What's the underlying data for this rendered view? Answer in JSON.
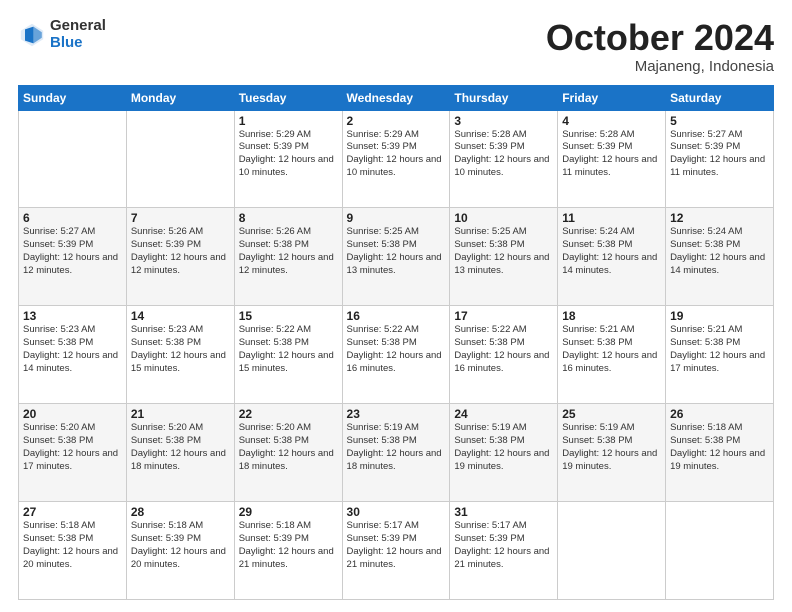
{
  "header": {
    "logo_general": "General",
    "logo_blue": "Blue",
    "title": "October 2024",
    "location": "Majaneng, Indonesia"
  },
  "weekdays": [
    "Sunday",
    "Monday",
    "Tuesday",
    "Wednesday",
    "Thursday",
    "Friday",
    "Saturday"
  ],
  "rows": [
    [
      {
        "day": "",
        "info": ""
      },
      {
        "day": "",
        "info": ""
      },
      {
        "day": "1",
        "info": "Sunrise: 5:29 AM\nSunset: 5:39 PM\nDaylight: 12 hours and 10 minutes."
      },
      {
        "day": "2",
        "info": "Sunrise: 5:29 AM\nSunset: 5:39 PM\nDaylight: 12 hours and 10 minutes."
      },
      {
        "day": "3",
        "info": "Sunrise: 5:28 AM\nSunset: 5:39 PM\nDaylight: 12 hours and 10 minutes."
      },
      {
        "day": "4",
        "info": "Sunrise: 5:28 AM\nSunset: 5:39 PM\nDaylight: 12 hours and 11 minutes."
      },
      {
        "day": "5",
        "info": "Sunrise: 5:27 AM\nSunset: 5:39 PM\nDaylight: 12 hours and 11 minutes."
      }
    ],
    [
      {
        "day": "6",
        "info": "Sunrise: 5:27 AM\nSunset: 5:39 PM\nDaylight: 12 hours and 12 minutes."
      },
      {
        "day": "7",
        "info": "Sunrise: 5:26 AM\nSunset: 5:39 PM\nDaylight: 12 hours and 12 minutes."
      },
      {
        "day": "8",
        "info": "Sunrise: 5:26 AM\nSunset: 5:38 PM\nDaylight: 12 hours and 12 minutes."
      },
      {
        "day": "9",
        "info": "Sunrise: 5:25 AM\nSunset: 5:38 PM\nDaylight: 12 hours and 13 minutes."
      },
      {
        "day": "10",
        "info": "Sunrise: 5:25 AM\nSunset: 5:38 PM\nDaylight: 12 hours and 13 minutes."
      },
      {
        "day": "11",
        "info": "Sunrise: 5:24 AM\nSunset: 5:38 PM\nDaylight: 12 hours and 14 minutes."
      },
      {
        "day": "12",
        "info": "Sunrise: 5:24 AM\nSunset: 5:38 PM\nDaylight: 12 hours and 14 minutes."
      }
    ],
    [
      {
        "day": "13",
        "info": "Sunrise: 5:23 AM\nSunset: 5:38 PM\nDaylight: 12 hours and 14 minutes."
      },
      {
        "day": "14",
        "info": "Sunrise: 5:23 AM\nSunset: 5:38 PM\nDaylight: 12 hours and 15 minutes."
      },
      {
        "day": "15",
        "info": "Sunrise: 5:22 AM\nSunset: 5:38 PM\nDaylight: 12 hours and 15 minutes."
      },
      {
        "day": "16",
        "info": "Sunrise: 5:22 AM\nSunset: 5:38 PM\nDaylight: 12 hours and 16 minutes."
      },
      {
        "day": "17",
        "info": "Sunrise: 5:22 AM\nSunset: 5:38 PM\nDaylight: 12 hours and 16 minutes."
      },
      {
        "day": "18",
        "info": "Sunrise: 5:21 AM\nSunset: 5:38 PM\nDaylight: 12 hours and 16 minutes."
      },
      {
        "day": "19",
        "info": "Sunrise: 5:21 AM\nSunset: 5:38 PM\nDaylight: 12 hours and 17 minutes."
      }
    ],
    [
      {
        "day": "20",
        "info": "Sunrise: 5:20 AM\nSunset: 5:38 PM\nDaylight: 12 hours and 17 minutes."
      },
      {
        "day": "21",
        "info": "Sunrise: 5:20 AM\nSunset: 5:38 PM\nDaylight: 12 hours and 18 minutes."
      },
      {
        "day": "22",
        "info": "Sunrise: 5:20 AM\nSunset: 5:38 PM\nDaylight: 12 hours and 18 minutes."
      },
      {
        "day": "23",
        "info": "Sunrise: 5:19 AM\nSunset: 5:38 PM\nDaylight: 12 hours and 18 minutes."
      },
      {
        "day": "24",
        "info": "Sunrise: 5:19 AM\nSunset: 5:38 PM\nDaylight: 12 hours and 19 minutes."
      },
      {
        "day": "25",
        "info": "Sunrise: 5:19 AM\nSunset: 5:38 PM\nDaylight: 12 hours and 19 minutes."
      },
      {
        "day": "26",
        "info": "Sunrise: 5:18 AM\nSunset: 5:38 PM\nDaylight: 12 hours and 19 minutes."
      }
    ],
    [
      {
        "day": "27",
        "info": "Sunrise: 5:18 AM\nSunset: 5:38 PM\nDaylight: 12 hours and 20 minutes."
      },
      {
        "day": "28",
        "info": "Sunrise: 5:18 AM\nSunset: 5:39 PM\nDaylight: 12 hours and 20 minutes."
      },
      {
        "day": "29",
        "info": "Sunrise: 5:18 AM\nSunset: 5:39 PM\nDaylight: 12 hours and 21 minutes."
      },
      {
        "day": "30",
        "info": "Sunrise: 5:17 AM\nSunset: 5:39 PM\nDaylight: 12 hours and 21 minutes."
      },
      {
        "day": "31",
        "info": "Sunrise: 5:17 AM\nSunset: 5:39 PM\nDaylight: 12 hours and 21 minutes."
      },
      {
        "day": "",
        "info": ""
      },
      {
        "day": "",
        "info": ""
      }
    ]
  ]
}
